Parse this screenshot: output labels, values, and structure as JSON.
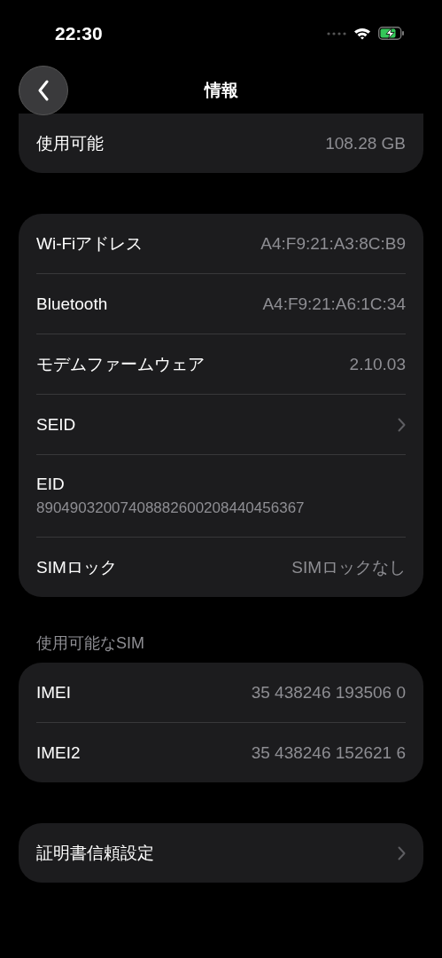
{
  "status_bar": {
    "time": "22:30"
  },
  "nav": {
    "title": "情報"
  },
  "sections": [
    {
      "rows": [
        {
          "kind": "value",
          "label": "使用可能",
          "value": "108.28 GB"
        }
      ]
    },
    {
      "rows": [
        {
          "kind": "value",
          "label": "Wi-Fiアドレス",
          "value": "A4:F9:21:A3:8C:B9"
        },
        {
          "kind": "value",
          "label": "Bluetooth",
          "value": "A4:F9:21:A6:1C:34"
        },
        {
          "kind": "value",
          "label": "モデムファームウェア",
          "value": "2.10.03"
        },
        {
          "kind": "link",
          "label": "SEID"
        },
        {
          "kind": "stacked",
          "label": "EID",
          "value": "89049032007408882600208440456367"
        },
        {
          "kind": "value",
          "label": "SIMロック",
          "value": "SIMロックなし"
        }
      ]
    },
    {
      "header": "使用可能なSIM",
      "rows": [
        {
          "kind": "value",
          "label": "IMEI",
          "value": "35 438246 193506 0"
        },
        {
          "kind": "value",
          "label": "IMEI2",
          "value": "35 438246 152621 6"
        }
      ]
    },
    {
      "rows": [
        {
          "kind": "link",
          "label": "証明書信頼設定"
        }
      ]
    }
  ]
}
